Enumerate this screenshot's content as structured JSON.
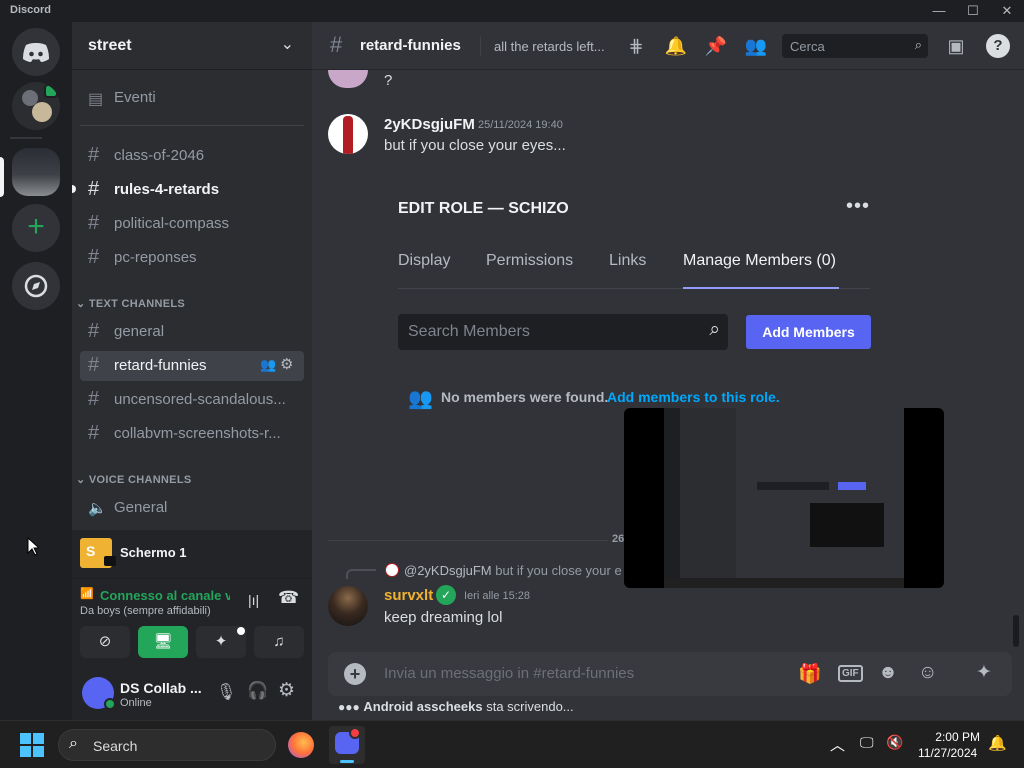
{
  "window": {
    "app_name": "Discord",
    "controls": [
      "—",
      "☐",
      "✕"
    ]
  },
  "rail": {
    "servers": [
      "discord-home",
      "server-1",
      "server-street",
      "add-server",
      "explore"
    ]
  },
  "guild": {
    "name": "street",
    "events_label": "Eventi",
    "pinned_channels": [
      "class-of-2046",
      "rules-4-retards",
      "political-compass",
      "pc-reponses"
    ],
    "text_category": "TEXT CHANNELS",
    "text_channels": [
      "general",
      "retard-funnies",
      "uncensored-scandalous...",
      "collabvm-screenshots-r..."
    ],
    "voice_category": "VOICE CHANNELS",
    "voice_channels": [
      "General"
    ]
  },
  "stream": {
    "avatar_letter": "S",
    "title": "Schermo 1"
  },
  "voice": {
    "status": "Connesso al canale vo",
    "channel": "Da boys (sempre affidabili)"
  },
  "user": {
    "name": "DS Collab ...",
    "status": "Online"
  },
  "channel_header": {
    "name": "retard-funnies",
    "topic": "all the retards left...",
    "search_placeholder": "Cerca"
  },
  "messages": [
    {
      "text": "?"
    },
    {
      "author": "2yKDsgjuFM",
      "time": "25/11/2024 19:40",
      "text": "but if you close your eyes..."
    },
    {
      "reply_to": "@2yKDsgjuFM",
      "reply_text": "but if you close your e",
      "author": "survxlt",
      "time": "Ieri alle 15:28",
      "text": "keep dreaming lol"
    }
  ],
  "edit_role": {
    "title": "EDIT ROLE — SCHIZO",
    "tabs": [
      "Display",
      "Permissions",
      "Links",
      "Manage Members (0)"
    ],
    "search_placeholder": "Search Members",
    "add_button": "Add Members",
    "empty_text": "No members were found.",
    "empty_link": "Add members to this role."
  },
  "date_divider": "26",
  "composer": {
    "placeholder": "Invia un messaggio in #retard-funnies",
    "gif_label": "GIF"
  },
  "typing": {
    "user": "Android asscheeks",
    "suffix": "sta scrivendo..."
  },
  "taskbar": {
    "search_label": "Search",
    "time": "2:00 PM",
    "date": "11/27/2024"
  },
  "colors": {
    "accent": "#5865f2",
    "green": "#23a55a",
    "link": "#00a8fc"
  }
}
